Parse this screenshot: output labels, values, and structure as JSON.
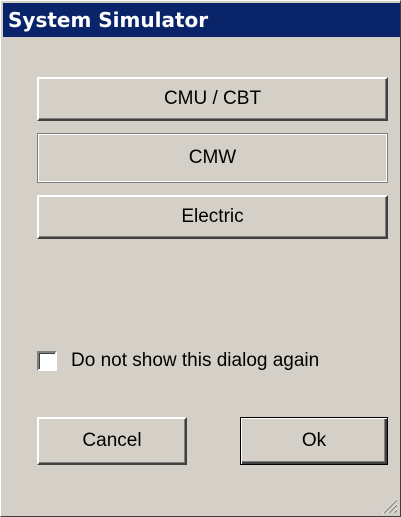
{
  "window": {
    "title": "System Simulator"
  },
  "buttons": {
    "cmu_cbt": "CMU / CBT",
    "cmw": "CMW",
    "electric": "Electric",
    "cancel": "Cancel",
    "ok": "Ok"
  },
  "checkbox": {
    "label": "Do not show this dialog again",
    "checked": false
  },
  "colors": {
    "titlebar": "#0a246a",
    "face": "#d4d0c8"
  },
  "icons": {
    "resize_grip": "resize-grip-icon"
  }
}
